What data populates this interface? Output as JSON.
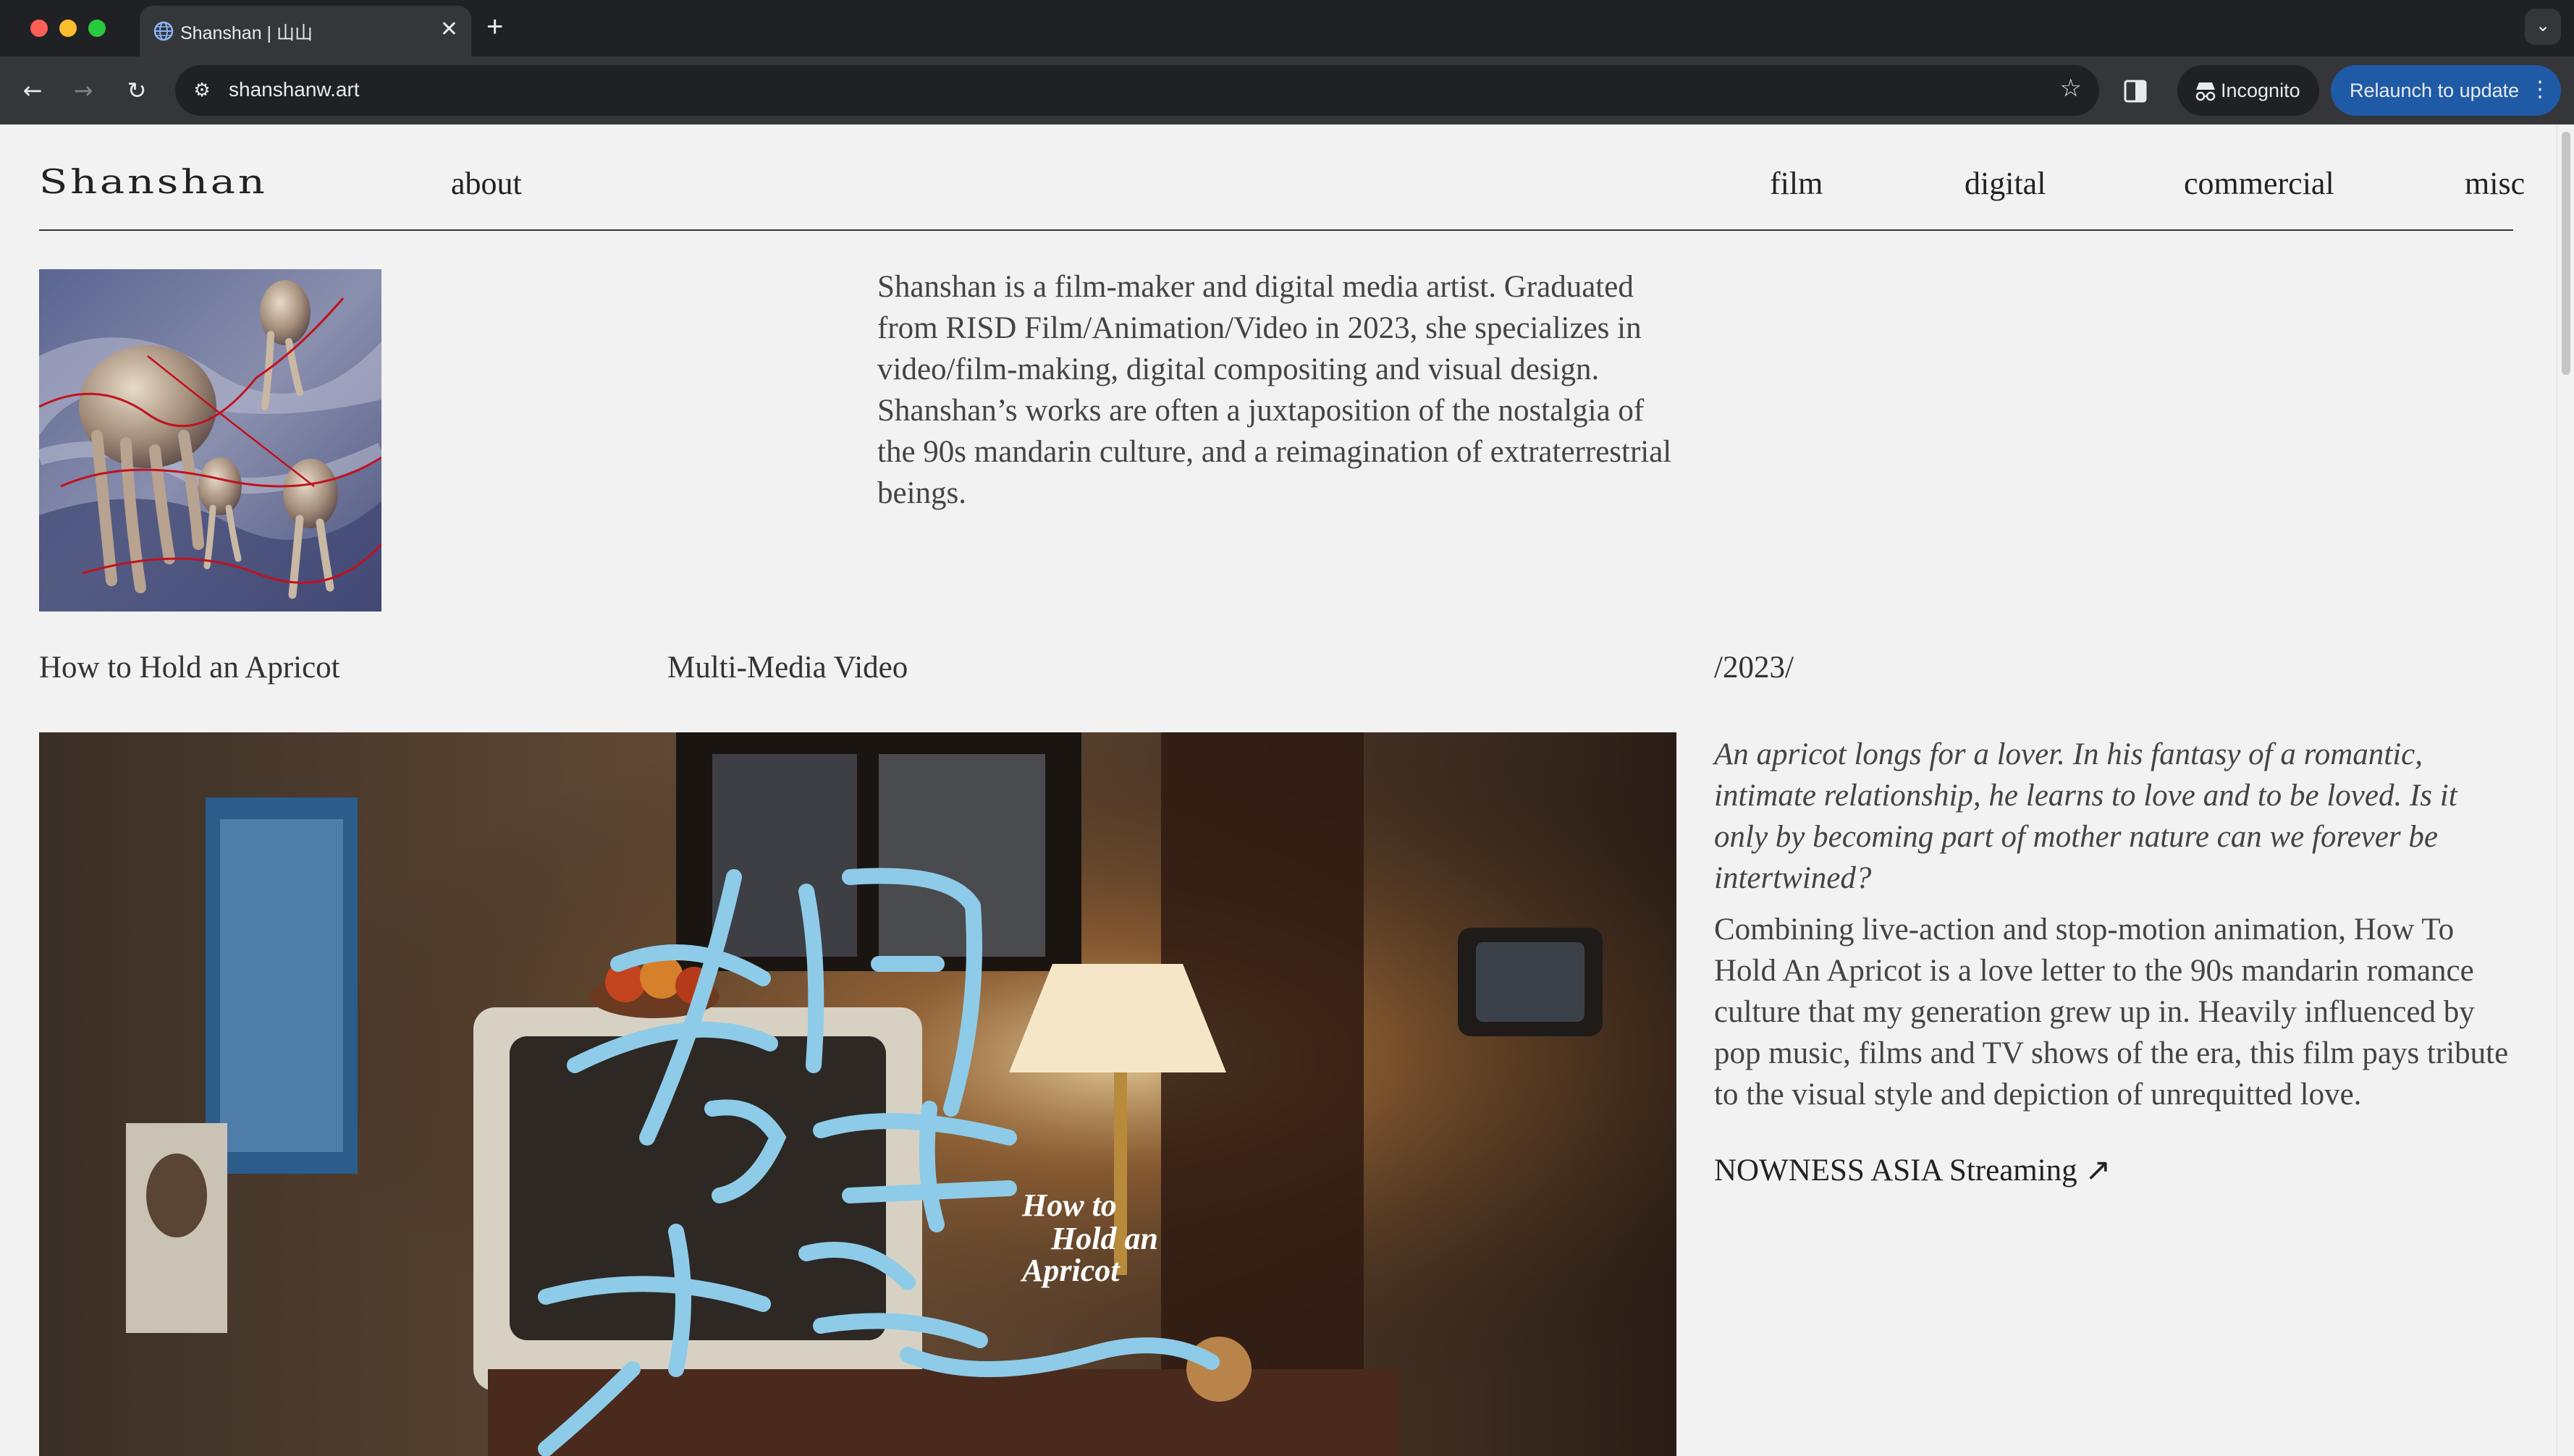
{
  "browser": {
    "tab_title": "Shanshan | 山山",
    "tab_close": "✕",
    "new_tab": "+",
    "url": "shanshanw.art",
    "incognito_label": "Incognito",
    "relaunch_label": "Relaunch to update",
    "tab_search": "⌄"
  },
  "site": {
    "logo": "Shanshan",
    "nav": {
      "about": "about",
      "film": "film",
      "digital": "digital",
      "commercial": "commercial",
      "misc": "misc"
    },
    "bio": "Shanshan is a film-maker and digital media artist. Graduated from RISD Film/Animation/Video in 2023, she specializes in video/film-making, digital compositing and visual design. Shanshan’s works are often a juxtaposition of the nostalgia of the 90s mandarin culture, and a reimagination of extraterrestrial beings.",
    "project": {
      "title": "How to Hold an Apricot",
      "medium": "Multi-Media Video",
      "year": "/2023/",
      "synopsis": "An apricot longs for a lover. In his fantasy of a romantic, intimate relationship, he learns to love and to be loved. Is it only by becoming part of mother nature can we forever be intertwined?",
      "description": "Combining live-action and stop-motion animation, How To Hold An Apricot is a love letter to the 90s mandarin romance culture that my generation grew up in. Heavily influenced by pop music, films and TV shows of the era, this film pays tribute to the visual style and depiction of unrequitted love.",
      "link_label": "NOWNESS ASIA Streaming ↗",
      "poster_title_line1": "How to",
      "poster_title_line2": "Hold an",
      "poster_title_line3": "Apricot",
      "poster_chinese": "如何留住一颗杏子"
    }
  },
  "colors": {
    "page_bg": "#f2f2f2",
    "chrome_dark": "#202124",
    "chrome_toolbar": "#35363a",
    "relaunch_blue": "#1f5aa6",
    "calligraphy_blue": "#8ecbe8"
  }
}
